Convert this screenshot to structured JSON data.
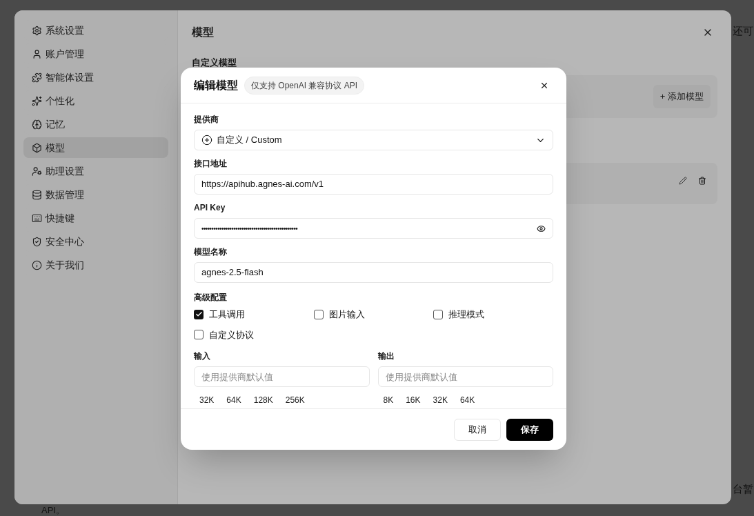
{
  "background_text": [
    "还可",
    "台暂",
    "API。"
  ],
  "settings": {
    "sidebar": {
      "items": [
        {
          "label": "系统设置",
          "selected": false
        },
        {
          "label": "账户管理",
          "selected": false
        },
        {
          "label": "智能体设置",
          "selected": false
        },
        {
          "label": "个性化",
          "selected": false
        },
        {
          "label": "记忆",
          "selected": false
        },
        {
          "label": "模型",
          "selected": true
        },
        {
          "label": "助理设置",
          "selected": false
        },
        {
          "label": "数据管理",
          "selected": false
        },
        {
          "label": "快捷键",
          "selected": false
        },
        {
          "label": "安全中心",
          "selected": false
        },
        {
          "label": "关于我们",
          "selected": false
        }
      ]
    },
    "title": "模型",
    "section": "自定义模型",
    "add_button": "+ 添加模型"
  },
  "modal": {
    "title": "编辑模型",
    "badge": "仅支持 OpenAI 兼容协议 API",
    "provider": {
      "label": "提供商",
      "value": "自定义 / Custom"
    },
    "endpoint": {
      "label": "接口地址",
      "value": "https://apihub.agnes-ai.com/v1"
    },
    "api_key": {
      "label": "API Key",
      "value": "••••••••••••••••••••••••••••••••••••••••••••••••"
    },
    "model_name": {
      "label": "模型名称",
      "value": "agnes-2.5-flash"
    },
    "advanced": {
      "label": "高级配置",
      "options": [
        {
          "label": "工具调用",
          "checked": true
        },
        {
          "label": "图片输入",
          "checked": false
        },
        {
          "label": "推理模式",
          "checked": false
        },
        {
          "label": "自定义协议",
          "checked": false
        }
      ]
    },
    "limits": [
      {
        "label": "输入",
        "placeholder": "使用提供商默认值",
        "presets": [
          "32K",
          "64K",
          "128K",
          "256K"
        ]
      },
      {
        "label": "输出",
        "placeholder": "使用提供商默认值",
        "presets": [
          "8K",
          "16K",
          "32K",
          "64K"
        ]
      }
    ],
    "buttons": {
      "cancel": "取消",
      "save": "保存"
    }
  }
}
